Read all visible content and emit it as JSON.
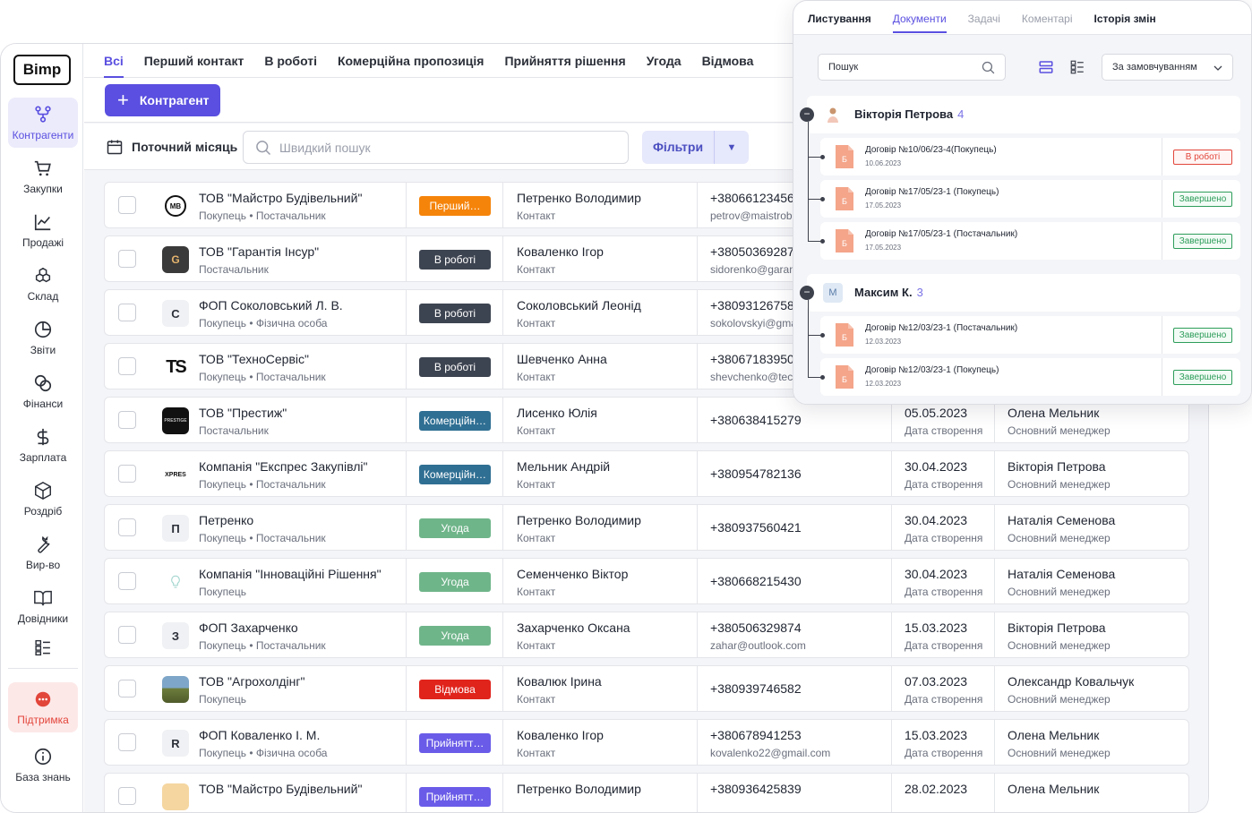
{
  "logo": "Bimp",
  "sidebar": {
    "items": [
      {
        "label": "Контрагенти",
        "icon": "network-icon"
      },
      {
        "label": "Закупки",
        "icon": "cart-icon"
      },
      {
        "label": "Продажі",
        "icon": "chart-line-icon"
      },
      {
        "label": "Склад",
        "icon": "boxes-icon"
      },
      {
        "label": "Звіти",
        "icon": "pie-chart-icon"
      },
      {
        "label": "Фінанси",
        "icon": "coins-icon"
      },
      {
        "label": "Зарплата",
        "icon": "dollar-icon"
      },
      {
        "label": "Роздріб",
        "icon": "box-icon"
      },
      {
        "label": "Вир-во",
        "icon": "wrench-icon"
      },
      {
        "label": "Довідники",
        "icon": "book-icon"
      },
      {
        "label": "",
        "icon": "list-icon"
      }
    ],
    "support": "Підтримка",
    "knowledge": "База знань"
  },
  "tabs": [
    "Всі",
    "Перший контакт",
    "В роботі",
    "Комерційна пропозиція",
    "Прийняття рішення",
    "Угода",
    "Відмова"
  ],
  "add_button": "Контрагент",
  "period": "Поточний місяць",
  "quick_search_placeholder": "Швидкий пошук",
  "filters_button": "Фільтри",
  "colors": {
    "accent": "#5a4fe0",
    "first": "#f5840b",
    "work": "#3d4451",
    "commercial": "#2f6f93",
    "deal": "#6fb58a",
    "reject": "#e0241c",
    "decision": "#6a5ce8"
  },
  "rows": [
    {
      "name": "ТОВ \"Майстро Будівельний\"",
      "type": "Покупець • Постачальник",
      "status": "Перший…",
      "status_color": "#f5840b",
      "contact": "Петренко Володимир",
      "contact_role": "Контакт",
      "phone": "+38066123456",
      "email": "petrov@maistrobud",
      "date": "",
      "date_label": "",
      "manager": "",
      "manager_label": "",
      "avatar": "MB",
      "avatar_style": "logo-mb"
    },
    {
      "name": "ТОВ \"Гарантія Інсур\"",
      "type": "Постачальник",
      "status": "В роботі",
      "status_color": "#3d4451",
      "contact": "Коваленко Ігор",
      "contact_role": "Контакт",
      "phone": "+38050369287",
      "email": "sidorenko@garan",
      "date": "",
      "date_label": "",
      "manager": "",
      "manager_label": "",
      "avatar": "G",
      "avatar_style": "logo-g"
    },
    {
      "name": "ФОП Соколовський Л. В.",
      "type": "Покупець • Фізична особа",
      "status": "В роботі",
      "status_color": "#3d4451",
      "contact": "Соколовський Леонід",
      "contact_role": "Контакт",
      "phone": "+38093126758",
      "email": "sokolovskyi@gma",
      "date": "",
      "date_label": "",
      "manager": "",
      "manager_label": "",
      "avatar": "С",
      "avatar_style": "letter"
    },
    {
      "name": "ТОВ \"ТехноСервіс\"",
      "type": "Покупець • Постачальник",
      "status": "В роботі",
      "status_color": "#3d4451",
      "contact": "Шевченко Анна",
      "contact_role": "Контакт",
      "phone": "+38067183950",
      "email": "shevchenko@tech",
      "date": "",
      "date_label": "",
      "manager": "",
      "manager_label": "",
      "avatar": "TS",
      "avatar_style": "logo-ts"
    },
    {
      "name": "ТОВ \"Престиж\"",
      "type": "Постачальник",
      "status": "Комерційн…",
      "status_color": "#2f6f93",
      "contact": "Лисенко Юлія",
      "contact_role": "Контакт",
      "phone": "+380638415279",
      "email": "",
      "date": "05.05.2023",
      "date_label": "Дата створення",
      "manager": "Олена Мельник",
      "manager_label": "Основний менеджер",
      "avatar": "PRESTIGE",
      "avatar_style": "logo-prestige"
    },
    {
      "name": "Компанія \"Експрес Закупівлі\"",
      "type": "Покупець • Постачальник",
      "status": "Комерційн…",
      "status_color": "#2f6f93",
      "contact": "Мельник Андрій",
      "contact_role": "Контакт",
      "phone": "+380954782136",
      "email": "",
      "date": "30.04.2023",
      "date_label": "Дата створення",
      "manager": "Вікторія Петрова",
      "manager_label": "Основний менеджер",
      "avatar": "XPRES",
      "avatar_style": "logo-xpres"
    },
    {
      "name": "Петренко",
      "type": "Покупець • Постачальник",
      "status": "Угода",
      "status_color": "#6fb58a",
      "contact": "Петренко Володимир",
      "contact_role": "Контакт",
      "phone": "+380937560421",
      "email": "",
      "date": "30.04.2023",
      "date_label": "Дата створення",
      "manager": "Наталія Семенова",
      "manager_label": "Основний менеджер",
      "avatar": "П",
      "avatar_style": "letter"
    },
    {
      "name": "Компанія \"Інноваційні Рішення\"",
      "type": "Покупець",
      "status": "Угода",
      "status_color": "#6fb58a",
      "contact": "Семенченко Віктор",
      "contact_role": "Контакт",
      "phone": "+380668215430",
      "email": "",
      "date": "30.04.2023",
      "date_label": "Дата створення",
      "manager": "Наталія Семенова",
      "manager_label": "Основний менеджер",
      "avatar": "",
      "avatar_style": "logo-bulb"
    },
    {
      "name": "ФОП Захарченко",
      "type": "Покупець • Постачальник",
      "status": "Угода",
      "status_color": "#6fb58a",
      "contact": "Захарченко Оксана",
      "contact_role": "Контакт",
      "phone": "+380506329874",
      "email": "zahar@outlook.com",
      "date": "15.03.2023",
      "date_label": "Дата створення",
      "manager": "Вікторія Петрова",
      "manager_label": "Основний менеджер",
      "avatar": "З",
      "avatar_style": "letter"
    },
    {
      "name": "ТОВ \"Агрохолдінг\"",
      "type": "Покупець",
      "status": "Відмова",
      "status_color": "#e0241c",
      "contact": "Ковалюк Ірина",
      "contact_role": "Контакт",
      "phone": "+380939746582",
      "email": "",
      "date": "07.03.2023",
      "date_label": "Дата створення",
      "manager": "Олександр Ковальчук",
      "manager_label": "Основний менеджер",
      "avatar": "",
      "avatar_style": "logo-agro"
    },
    {
      "name": "ФОП Коваленко І. М.",
      "type": "Покупець • Фізична особа",
      "status": "Прийнятт…",
      "status_color": "#6a5ce8",
      "contact": "Коваленко Ігор",
      "contact_role": "Контакт",
      "phone": "+380678941253",
      "email": "kovalenko22@gmail.com",
      "date": "15.03.2023",
      "date_label": "Дата створення",
      "manager": "Олена Мельник",
      "manager_label": "Основний менеджер",
      "avatar": "R",
      "avatar_style": "letter"
    },
    {
      "name": "ТОВ \"Майстро Будівельний\"",
      "type": "",
      "status": "Прийнятт…",
      "status_color": "#6a5ce8",
      "contact": "Петренко Володимир",
      "contact_role": "",
      "phone": "+380936425839",
      "email": "",
      "date": "28.02.2023",
      "date_label": "",
      "manager": "Олена Мельник",
      "manager_label": "",
      "avatar": "",
      "avatar_style": "logo-cake"
    }
  ],
  "panel": {
    "tabs": [
      "Листування",
      "Документи",
      "Задачі",
      "Коментарі",
      "Історія змін"
    ],
    "search_value": "Пошук",
    "sort_label": "За замовчуванням",
    "groups": [
      {
        "name": "Вікторія Петрова",
        "count": "4",
        "avatar": "",
        "docs": [
          {
            "title": "Договір №10/06/23-4(Покупець)",
            "date": "10.06.2023",
            "status": "В роботі",
            "kind": "work",
            "icon_letter": "Б"
          },
          {
            "title": "Договір №17/05/23-1 (Покупець)",
            "date": "17.05.2023",
            "status": "Завершено",
            "kind": "done",
            "icon_letter": "Б"
          },
          {
            "title": "Договір №17/05/23-1 (Постачальник)",
            "date": "17.05.2023",
            "status": "Завершено",
            "kind": "done",
            "icon_letter": "Б"
          }
        ]
      },
      {
        "name": "Максим К.",
        "count": "3",
        "avatar": "M",
        "docs": [
          {
            "title": "Договір №12/03/23-1 (Постачальник)",
            "date": "12.03.2023",
            "status": "Завершено",
            "kind": "done",
            "icon_letter": "Б"
          },
          {
            "title": "Договір №12/03/23-1 (Покупець)",
            "date": "12.03.2023",
            "status": "Завершено",
            "kind": "done",
            "icon_letter": "Б"
          }
        ]
      }
    ]
  }
}
